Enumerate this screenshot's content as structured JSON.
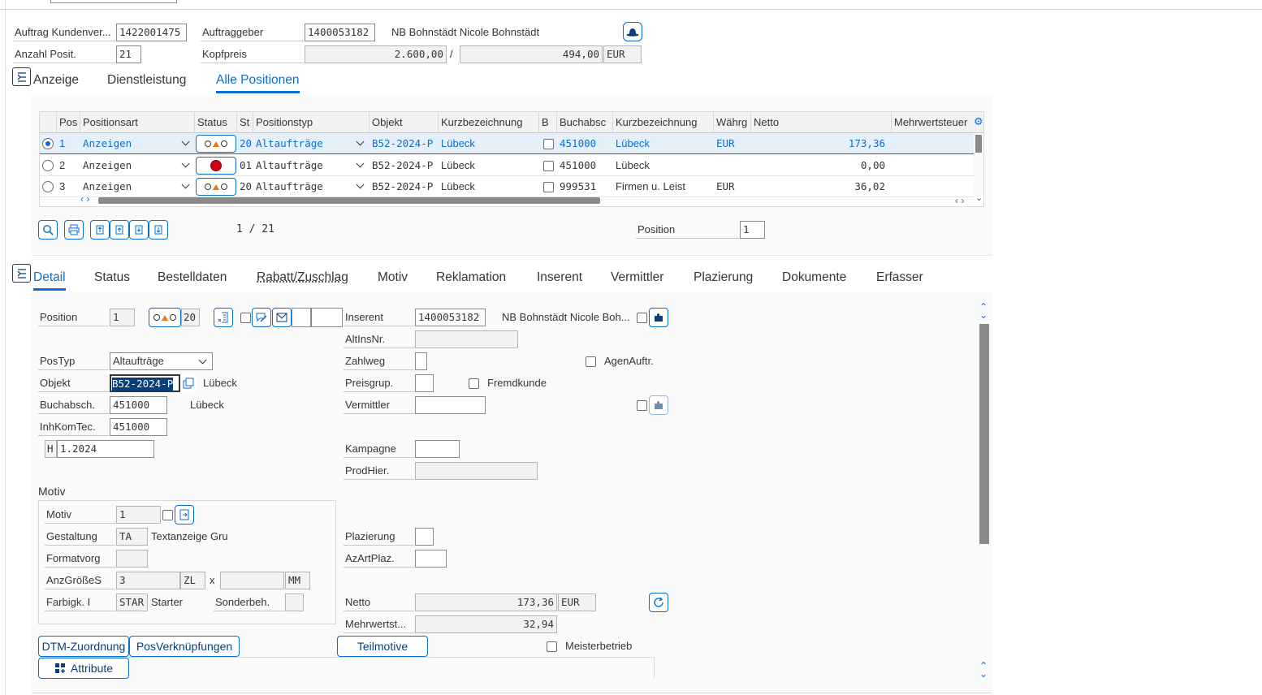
{
  "header": {
    "auftrag_label": "Auftrag Kundenver...",
    "auftrag_value": "1422001475",
    "auftraggeber_label": "Auftraggeber",
    "auftraggeber_value": "1400053182",
    "auftraggeber_name": "NB Bohnstädt Nicole Bohnstädt",
    "anzahl_label": "Anzahl Posit.",
    "anzahl_value": "21",
    "kopfpreis_label": "Kopfpreis",
    "kopfpreis_value": "2.600,00",
    "kopfpreis_sep": "/",
    "kopfpreis_value2": "494,00",
    "currency": "EUR"
  },
  "tabs_top": [
    "Anzeige",
    "Dienstleistung",
    "Alle Positionen"
  ],
  "table": {
    "columns": [
      "Pos",
      "Positionsart",
      "Status",
      "St",
      "Positionstyp",
      "Objekt",
      "Kurzbezeichnung",
      "B",
      "Buchabsc",
      "Kurzbezeichnung",
      "Währg",
      "Netto",
      "Mehrwertsteuer"
    ],
    "rows": [
      {
        "pos": "1",
        "art": "Anzeigen",
        "status": "ok",
        "st": "20",
        "typ": "Altaufträge",
        "objekt": "B52-2024-P",
        "kurz": "Lübeck",
        "buch": "451000",
        "kurz2": "Lübeck",
        "waehrg": "EUR",
        "netto": "173,36",
        "selected": true
      },
      {
        "pos": "2",
        "art": "Anzeigen",
        "status": "stop",
        "st": "01",
        "typ": "Altaufträge",
        "objekt": "B52-2024-P",
        "kurz": "Lübeck",
        "buch": "451000",
        "kurz2": "Lübeck",
        "waehrg": "",
        "netto": "0,00",
        "selected": false
      },
      {
        "pos": "3",
        "art": "Anzeigen",
        "status": "ok",
        "st": "20",
        "typ": "Altaufträge",
        "objekt": "B52-2024-P",
        "kurz": "Lübeck",
        "buch": "999531",
        "kurz2": "Firmen u. Leist",
        "waehrg": "EUR",
        "netto": "36,02",
        "selected": false
      }
    ],
    "pager": "1 / 21",
    "position_label": "Position",
    "position_value": "1"
  },
  "tabs_detail": [
    "Detail",
    "Status",
    "Bestelldaten",
    "Rabatt/Zuschlag",
    "Motiv",
    "Reklamation",
    "Inserent",
    "Vermittler",
    "Plazierung",
    "Dokumente",
    "Erfasser"
  ],
  "detail": {
    "position_label": "Position",
    "position_value": "1",
    "status_num": "20",
    "postyp_label": "PosTyp",
    "postyp_value": "Altaufträge",
    "objekt_label": "Objekt",
    "objekt_value": "B52-2024-P",
    "objekt_text": "Lübeck",
    "buchabsch_label": "Buchabsch.",
    "buchabsch_value": "451000",
    "buchabsch_text": "Lübeck",
    "inhkom_label": "InhKomTec.",
    "inhkom_value": "451000",
    "h_value": "H",
    "period_value": "1.2024",
    "inserent_label": "Inserent",
    "inserent_value": "1400053182",
    "inserent_name": "NB Bohnstädt Nicole Boh...",
    "altins_label": "AltInsNr.",
    "zahlweg_label": "Zahlweg",
    "agenauftr_label": "AgenAuftr.",
    "preisgrup_label": "Preisgrup.",
    "fremdkunde_label": "Fremdkunde",
    "vermittler_label": "Vermittler",
    "kampagne_label": "Kampagne",
    "prodhier_label": "ProdHier.",
    "motiv_title": "Motiv",
    "motiv_label": "Motiv",
    "motiv_value": "1",
    "gestaltung_label": "Gestaltung",
    "gestaltung_value": "TA",
    "gestaltung_text": "Textanzeige Gru",
    "formatvorg_label": "Formatvorg",
    "anzgroesse_label": "AnzGrößeS",
    "anzgroesse_value": "3",
    "anzgroesse_unit": "ZL",
    "x_label": "x",
    "mm_unit": "MM",
    "farbigk_label": "Farbigk. I",
    "farbigk_value": "STAR",
    "farbigk_text": "Starter",
    "sonderbeh_label": "Sonderbeh.",
    "plazierung_label": "Plazierung",
    "azartplaz_label": "AzArtPlaz.",
    "netto_label": "Netto",
    "netto_value": "173,36",
    "netto_currency": "EUR",
    "mwst_label": "Mehrwertst...",
    "mwst_value": "32,94",
    "meisterbetrieb_label": "Meisterbetrieb"
  },
  "buttons": {
    "dtm": "DTM-Zuordnung",
    "posverk": "PosVerknüpfungen",
    "teilmotive": "Teilmotive",
    "attribute": "Attribute"
  },
  "colors": {
    "accent": "#0a6ed1",
    "selected_row": "#e5f0fa",
    "stop": "#d0021b",
    "warning": "#e9730c"
  }
}
